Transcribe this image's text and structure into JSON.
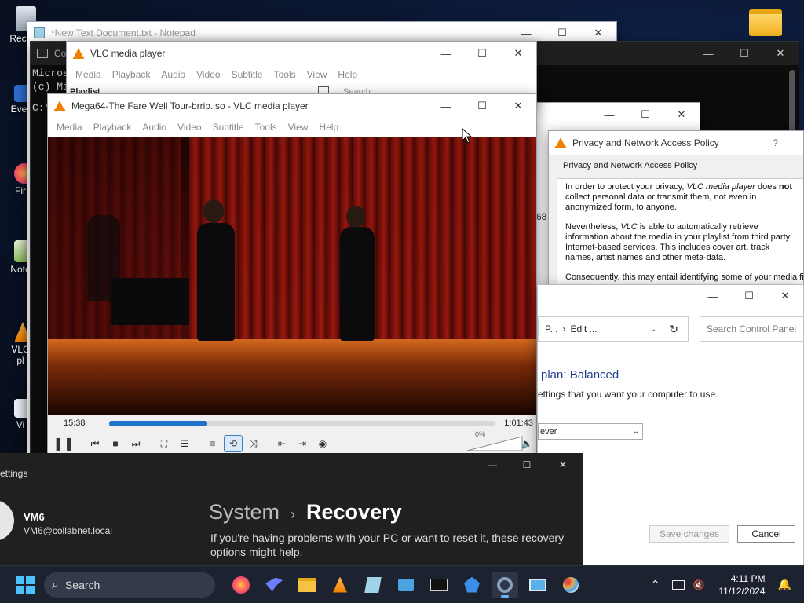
{
  "desktop": {
    "icons": [
      {
        "label": "Recy",
        "icon": "recycle-bin-icon"
      },
      {
        "label": "Ever",
        "icon": "shortcut-icon"
      },
      {
        "label": "Fir",
        "icon": "firefox-icon"
      },
      {
        "label": "Note",
        "icon": "notepad-icon"
      },
      {
        "label": "VLC",
        "icon": "vlc-icon"
      },
      {
        "label": "pl",
        "icon": "vlc-icon"
      },
      {
        "label": "Vi",
        "icon": "app-icon"
      }
    ]
  },
  "notepad": {
    "title": "*New Text Document.txt - Notepad"
  },
  "cmd": {
    "title": "Co",
    "lines": [
      "Micros",
      "(c) Mi",
      "C:\\"
    ]
  },
  "vlc_playlist": {
    "title": "VLC media player",
    "menu": [
      "Media",
      "Playback",
      "Audio",
      "Video",
      "Subtitle",
      "Tools",
      "View",
      "Help"
    ],
    "playlist_label": "Playlist",
    "search_placeholder": "Search"
  },
  "vlc_main": {
    "title": "Mega64-The Fare Well Tour-brrip.iso - VLC media player",
    "menu": [
      "Media",
      "Playback",
      "Audio",
      "Video",
      "Subtitle",
      "Tools",
      "View",
      "Help"
    ],
    "time_elapsed": "15:38",
    "time_total": "1:01:43",
    "progress": 0.255,
    "volume_label": "0%",
    "volume": 0
  },
  "privacy_dialog": {
    "title": "Privacy and Network Access Policy",
    "help": "?",
    "heading": "Privacy and Network Access Policy",
    "p1_a": "In order to protect your privacy, ",
    "p1_b": "VLC media player",
    "p1_c": " does ",
    "p1_d": "not",
    "p1_e": " collect personal data or transmit them, not even in anonymized form, to anyone.",
    "p2_a": "Nevertheless, ",
    "p2_b": "VLC",
    "p2_c": " is able to automatically retrieve information about the media in your playlist from third party Internet-based services. This includes cover art, track names, artist names and other meta-data.",
    "p3": "Consequently, this may entail identifying some of your media fil"
  },
  "bg_window": {
    "fragment": "68"
  },
  "control_panel": {
    "breadcrumb_a": "P...",
    "breadcrumb_sep": "›",
    "breadcrumb_b": "Edit ...",
    "search_placeholder": "Search Control Panel",
    "heading": "plan: Balanced",
    "subtext": "ettings that you want your computer to use.",
    "select_value": "ever",
    "save_label": "Save changes",
    "cancel_label": "Cancel"
  },
  "settings": {
    "title": "ettings",
    "user_name": "VM6",
    "user_email": "VM6@collabnet.local",
    "crumb_parent": "System",
    "crumb_sep": "›",
    "crumb_current": "Recovery",
    "description": "If you're having problems with your PC or want to reset it, these recovery options might help."
  },
  "taskbar": {
    "search_label": "Search",
    "apps": [
      {
        "icon": "firefox-icon",
        "color": "#ff7139"
      },
      {
        "icon": "hummingbird-icon",
        "color": "#6c7cff"
      },
      {
        "icon": "file-explorer-icon",
        "color": "#f5c242"
      },
      {
        "icon": "vlc-icon",
        "color": "#f08000"
      },
      {
        "icon": "notepad-icon",
        "color": "#9fd3e8"
      },
      {
        "icon": "app-window-icon",
        "color": "#4aa3df"
      },
      {
        "icon": "terminal-icon",
        "color": "#cfcfcf"
      },
      {
        "icon": "network-icon",
        "color": "#3d8ee6"
      },
      {
        "icon": "settings-icon",
        "color": "#8aa0b8"
      },
      {
        "icon": "remote-desktop-icon",
        "color": "#5bb0e8"
      },
      {
        "icon": "paint-icon",
        "color": "#e8b04a"
      }
    ],
    "time": "4:11 PM",
    "date": "11/12/2024"
  }
}
